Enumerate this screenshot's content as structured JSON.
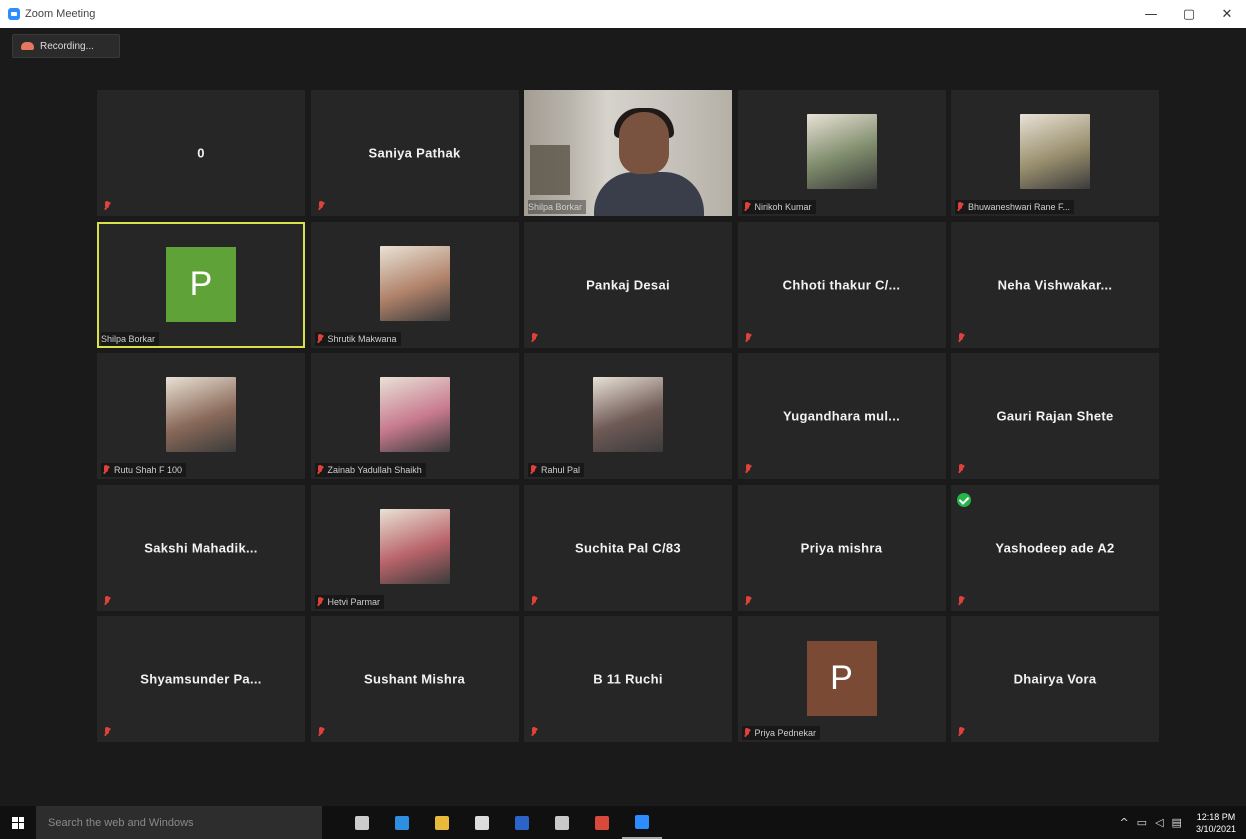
{
  "window": {
    "title": "Zoom Meeting",
    "controls": {
      "minimize": "—",
      "restore": "▢",
      "close": "✕"
    }
  },
  "recording": {
    "label": "Recording..."
  },
  "tiles": [
    {
      "name": "0",
      "label": "",
      "type": "name",
      "muted": true
    },
    {
      "name": "Saniya Pathak",
      "label": "",
      "type": "name",
      "muted": true
    },
    {
      "name": "",
      "label": "Shilpa Borkar",
      "type": "video",
      "muted": false
    },
    {
      "name": "",
      "label": "Nirikoh Kumar",
      "type": "photo",
      "photo_color": "#7d8b6a",
      "muted": true
    },
    {
      "name": "",
      "label": "Bhuwaneshwari Rane F...",
      "type": "photo",
      "photo_color": "#9a8f6e",
      "muted": true
    },
    {
      "name": "P",
      "label": "Shilpa Borkar",
      "type": "letter",
      "letter_color": "#5fa338",
      "muted": false,
      "active": true
    },
    {
      "name": "",
      "label": "Shrutik Makwana",
      "type": "photo",
      "photo_color": "#b0826a",
      "muted": true
    },
    {
      "name": "Pankaj Desai",
      "label": "",
      "type": "name",
      "muted": true
    },
    {
      "name": "Chhoti thakur C/...",
      "label": "",
      "type": "name",
      "muted": true
    },
    {
      "name": "Neha Vishwakar...",
      "label": "",
      "type": "name",
      "muted": true
    },
    {
      "name": "",
      "label": "Rutu Shah F 100",
      "type": "photo",
      "photo_color": "#8a6a5a",
      "muted": true
    },
    {
      "name": "",
      "label": "Zainab Yadullah Shaikh",
      "type": "photo",
      "photo_color": "#c77a8e",
      "muted": true
    },
    {
      "name": "",
      "label": "Rahul Pal",
      "type": "photo",
      "photo_color": "#6f5a56",
      "muted": true
    },
    {
      "name": "Yugandhara mul...",
      "label": "",
      "type": "name",
      "muted": true
    },
    {
      "name": "Gauri Rajan Shete",
      "label": "",
      "type": "name",
      "muted": true
    },
    {
      "name": "Sakshi Mahadik...",
      "label": "",
      "type": "name",
      "muted": true
    },
    {
      "name": "",
      "label": "Hetvi Parmar",
      "type": "photo",
      "photo_color": "#b9646a",
      "muted": true
    },
    {
      "name": "Suchita Pal C/83",
      "label": "",
      "type": "name",
      "muted": true
    },
    {
      "name": "Priya mishra",
      "label": "",
      "type": "name",
      "muted": true
    },
    {
      "name": "Yashodeep ade A2",
      "label": "",
      "type": "name",
      "muted": true,
      "check": true
    },
    {
      "name": "Shyamsunder Pa...",
      "label": "",
      "type": "name",
      "muted": true
    },
    {
      "name": "Sushant Mishra",
      "label": "",
      "type": "name",
      "muted": true
    },
    {
      "name": "B 11 Ruchi",
      "label": "",
      "type": "name",
      "muted": true
    },
    {
      "name": "P",
      "label": "Priya Pednekar",
      "type": "letter",
      "letter_color": "#7a4a35",
      "muted": true
    },
    {
      "name": "Dhairya Vora",
      "label": "",
      "type": "name",
      "muted": true
    }
  ],
  "taskbar": {
    "search_placeholder": "Search the web and Windows",
    "apps": [
      {
        "icon": "task-view-icon",
        "color": "#cccccc"
      },
      {
        "icon": "edge-icon",
        "color": "#2e8fe0"
      },
      {
        "icon": "file-explorer-icon",
        "color": "#e8b93a"
      },
      {
        "icon": "store-icon",
        "color": "#dddddd"
      },
      {
        "icon": "word-icon",
        "color": "#2b63c9"
      },
      {
        "icon": "paint-icon",
        "color": "#c9c9c9"
      },
      {
        "icon": "chrome-icon",
        "color": "#d9493b"
      },
      {
        "icon": "zoom-icon",
        "color": "#2d8cff"
      }
    ],
    "tray": {
      "time": "12:18 PM",
      "date": "3/10/2021"
    }
  }
}
